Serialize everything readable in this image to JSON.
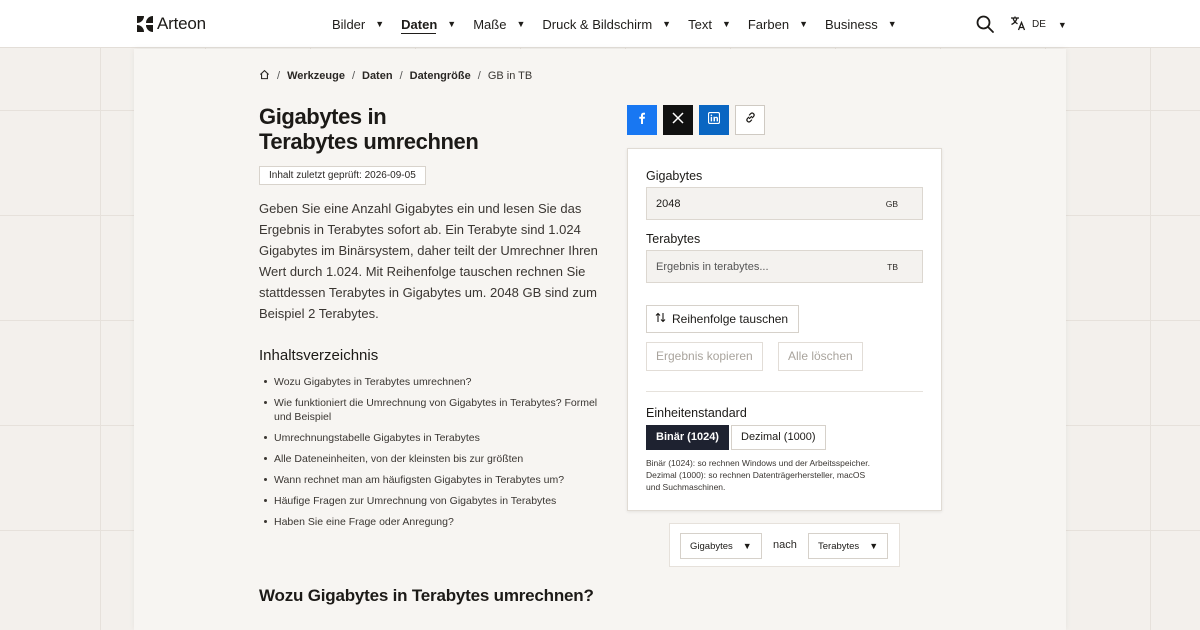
{
  "header": {
    "logo_text": "Arteon",
    "nav": [
      {
        "label": "Bilder",
        "active": false
      },
      {
        "label": "Daten",
        "active": true
      },
      {
        "label": "Maße",
        "active": false
      },
      {
        "label": "Druck & Bildschirm",
        "active": false
      },
      {
        "label": "Text",
        "active": false
      },
      {
        "label": "Farben",
        "active": false
      },
      {
        "label": "Business",
        "active": false
      }
    ],
    "caret": "▼",
    "language": "DE"
  },
  "breadcrumb": {
    "items": [
      "Werkzeuge",
      "Daten",
      "Datengröße"
    ],
    "current": "GB in TB",
    "separator": "/"
  },
  "page": {
    "title_line1": "Gigabytes in",
    "title_line2": "Terabytes umrechnen",
    "reviewed": "Inhalt zuletzt geprüft: 2026-09-05",
    "intro": "Geben Sie eine Anzahl Gigabytes ein und lesen Sie das Ergebnis in Terabytes sofort ab. Ein Terabyte sind 1.024 Gigabytes im Binärsystem, daher teilt der Umrechner Ihren Wert durch 1.024. Mit Reihenfolge tauschen rechnen Sie stattdessen Terabytes in Gigabytes um. 2048 GB sind zum Beispiel 2 Terabytes.",
    "toc_title": "Inhaltsverzeichnis",
    "toc": [
      "Wozu Gigabytes in Terabytes umrechnen?",
      "Wie funktioniert die Umrechnung von Gigabytes in Terabytes? Formel und Beispiel",
      "Umrechnungstabelle Gigabytes in Terabytes",
      "Alle Dateneinheiten, von der kleinsten bis zur größten",
      "Wann rechnet man am häufigsten Gigabytes in Terabytes um?",
      "Häufige Fragen zur Umrechnung von Gigabytes in Terabytes",
      "Haben Sie eine Frage oder Anregung?"
    ],
    "section_heading": "Wozu Gigabytes in Terabytes umrechnen?"
  },
  "converter": {
    "from_label": "Gigabytes",
    "from_value": "2048",
    "from_unit": "GB",
    "to_label": "Terabytes",
    "to_placeholder": "Ergebnis in terabytes...",
    "to_unit": "TB",
    "swap_label": "Reihenfolge tauschen",
    "copy_label": "Ergebnis kopieren",
    "clear_label": "Alle löschen",
    "standard_label": "Einheitenstandard",
    "binary_label": "Binär (1024)",
    "decimal_label": "Dezimal (1000)",
    "note_line1": "Binär (1024): so rechnen Windows und der Arbeitsspeicher.",
    "note_line2": "Dezimal (1000): so rechnen Datenträgerhersteller, macOS",
    "note_line3": "und Suchmaschinen."
  },
  "unit_selector": {
    "from": "Gigabytes",
    "connector": "nach",
    "to": "Terabytes"
  },
  "colors": {
    "facebook": "#1877f2",
    "x": "#111111",
    "linkedin": "#0a66c2",
    "selected_segment": "#1e2230"
  },
  "icons": [
    "home-icon",
    "search-icon",
    "translate-icon",
    "facebook-icon",
    "x-icon",
    "linkedin-icon",
    "link-icon",
    "swap-icon"
  ]
}
